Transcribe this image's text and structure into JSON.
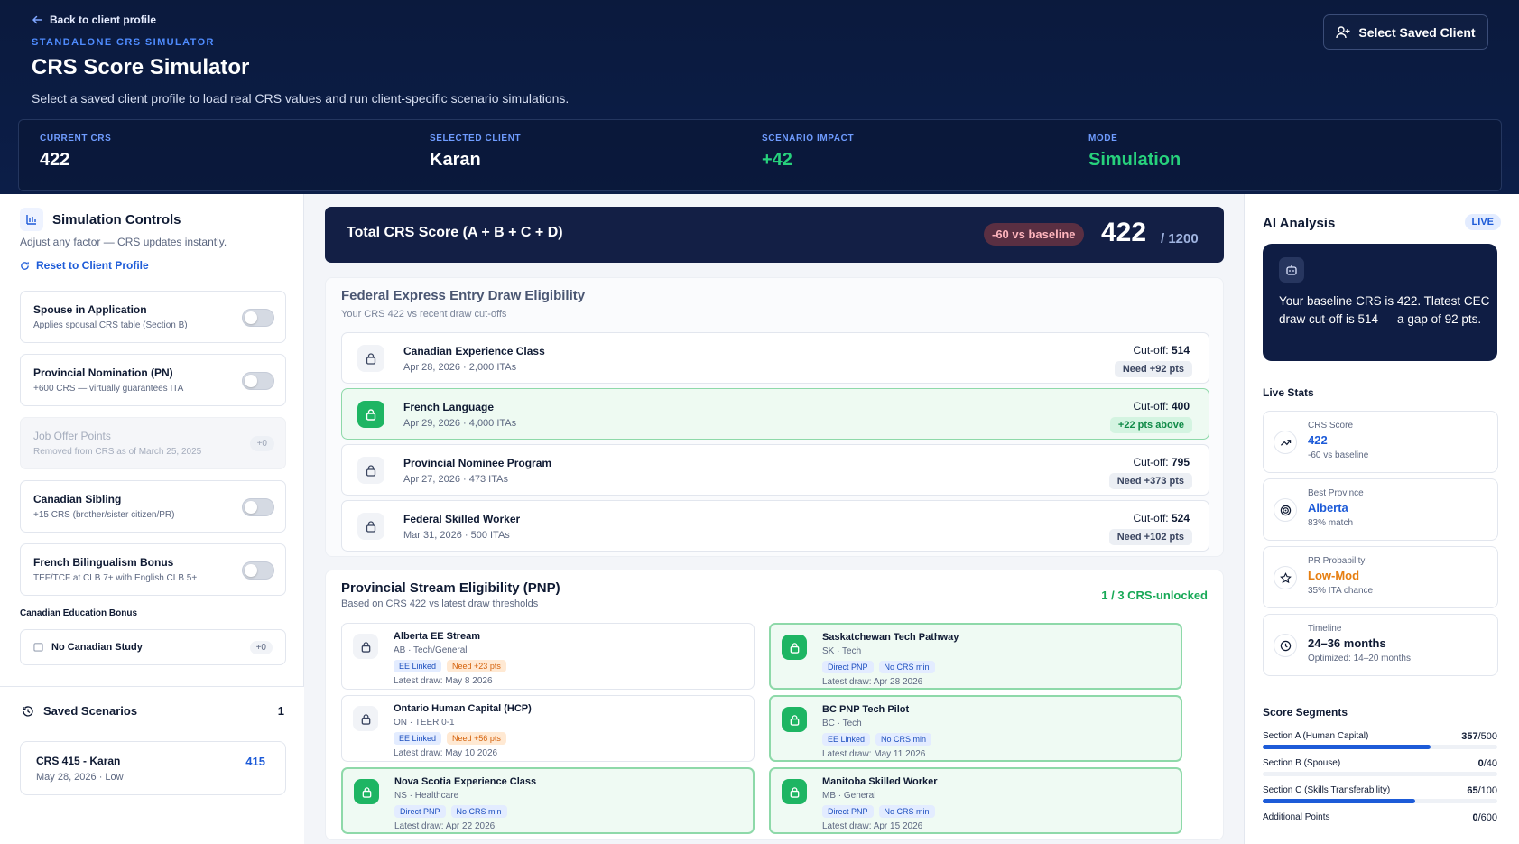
{
  "header": {
    "back_label": "Back to client profile",
    "eyebrow": "STANDALONE CRS SIMULATOR",
    "title": "CRS Score Simulator",
    "subtitle": "Select a saved client profile to load real CRS values and run client-specific scenario simulations.",
    "select_button": "Select Saved Client"
  },
  "stats": {
    "current_crs_label": "CURRENT CRS",
    "current_crs": "422",
    "client_label": "SELECTED CLIENT",
    "client": "Karan",
    "impact_label": "SCENARIO IMPACT",
    "impact": "+42",
    "mode_label": "MODE",
    "mode": "Simulation"
  },
  "controls": {
    "title": "Simulation Controls",
    "subtitle": "Adjust any factor — CRS updates instantly.",
    "reset": "Reset to Client Profile",
    "toggles": [
      {
        "title": "Spouse in Application",
        "desc": "Applies spousal CRS table (Section B)",
        "on": false
      },
      {
        "title": "Provincial Nomination (PN)",
        "desc": "+600 CRS — virtually guarantees ITA",
        "on": false
      },
      {
        "title": "Job Offer Points",
        "desc": "Removed from CRS as of March 25, 2025",
        "pill": "+0"
      },
      {
        "title": "Canadian Sibling",
        "desc": "+15 CRS (brother/sister citizen/PR)",
        "on": false
      },
      {
        "title": "French Bilingualism Bonus",
        "desc": "TEF/TCF at CLB 7+ with English CLB 5+",
        "on": false
      }
    ],
    "education_label": "Canadian Education Bonus",
    "education_value": "No Canadian Study",
    "education_pts": "+0"
  },
  "saved": {
    "title": "Saved Scenarios",
    "count": "1",
    "items": [
      {
        "name": "CRS 415 - Karan",
        "meta": "May 28, 2026 · Low",
        "score": "415"
      }
    ]
  },
  "total": {
    "label": "Total CRS Score (A + B + C + D)",
    "vs": "-60 vs baseline",
    "score": "422",
    "max": "/ 1200"
  },
  "federal": {
    "title": "Federal Express Entry Draw Eligibility",
    "subtitle": "Your CRS 422 vs recent draw cut-offs",
    "rows": [
      {
        "name": "Canadian Experience Class",
        "meta": "Apr 28, 2026 · 2,000 ITAs",
        "cutoff_label": "Cut-off:",
        "cutoff": "514",
        "need": "Need +92 pts",
        "ok": false
      },
      {
        "name": "French Language",
        "meta": "Apr 29, 2026 · 4,000 ITAs",
        "cutoff_label": "Cut-off:",
        "cutoff": "400",
        "need": "+22 pts above",
        "ok": true
      },
      {
        "name": "Provincial Nominee Program",
        "meta": "Apr 27, 2026 · 473 ITAs",
        "cutoff_label": "Cut-off:",
        "cutoff": "795",
        "need": "Need +373 pts",
        "ok": false
      },
      {
        "name": "Federal Skilled Worker",
        "meta": "Mar 31, 2026 · 500 ITAs",
        "cutoff_label": "Cut-off:",
        "cutoff": "524",
        "need": "Need +102 pts",
        "ok": false
      }
    ]
  },
  "pnp": {
    "title": "Provincial Stream Eligibility (PNP)",
    "subtitle": "Based on CRS 422 vs latest draw thresholds",
    "unlocked": "1 / 3 CRS-unlocked",
    "items": [
      {
        "name": "Alberta EE Stream",
        "region": "AB · Tech/General",
        "tags": [
          "EE Linked",
          "Need +23 pts"
        ],
        "latest": "Latest draw: May 8 2026",
        "ok": false
      },
      {
        "name": "Saskatchewan Tech Pathway",
        "region": "SK · Tech",
        "tags": [
          "Direct PNP",
          "No CRS min"
        ],
        "latest": "Latest draw: Apr 28 2026",
        "ok": true
      },
      {
        "name": "Ontario Human Capital (HCP)",
        "region": "ON · TEER 0-1",
        "tags": [
          "EE Linked",
          "Need +56 pts"
        ],
        "latest": "Latest draw: May 10 2026",
        "ok": false
      },
      {
        "name": "BC PNP Tech Pilot",
        "region": "BC · Tech",
        "tags": [
          "EE Linked",
          "No CRS min"
        ],
        "latest": "Latest draw: May 11 2026",
        "ok": true
      },
      {
        "name": "Nova Scotia Experience Class",
        "region": "NS · Healthcare",
        "tags": [
          "Direct PNP",
          "No CRS min"
        ],
        "latest": "Latest draw: Apr 22 2026",
        "ok": true
      },
      {
        "name": "Manitoba Skilled Worker",
        "region": "MB · General",
        "tags": [
          "Direct PNP",
          "No CRS min"
        ],
        "latest": "Latest draw: Apr 15 2026",
        "ok": true
      }
    ]
  },
  "ai": {
    "title": "AI Analysis",
    "badge": "LIVE",
    "text": "Your baseline CRS is 422. Tlatest CEC draw cut-off is 514 — a gap of 92 pts."
  },
  "live_stats": {
    "title": "Live Stats",
    "cards": [
      {
        "label": "CRS Score",
        "value": "422",
        "sub": "-60 vs baseline",
        "icon": "trend-icon",
        "color": "blue"
      },
      {
        "label": "Best Province",
        "value": "Alberta",
        "sub": "83% match",
        "icon": "target-icon",
        "color": "blue"
      },
      {
        "label": "PR Probability",
        "value": "Low-Mod",
        "sub": "35% ITA chance",
        "icon": "star-icon",
        "color": "orange"
      },
      {
        "label": "Timeline",
        "value": "24–36 months",
        "sub": "Optimized: 14–20 months",
        "icon": "clock-icon",
        "color": "dark"
      }
    ]
  },
  "segments": {
    "title": "Score Segments",
    "items": [
      {
        "label": "Section A (Human Capital)",
        "value": "357",
        "max": "/500",
        "fraction": 0.714
      },
      {
        "label": "Section B (Spouse)",
        "value": "0",
        "max": "/40",
        "fraction": 0
      },
      {
        "label": "Section C (Skills Transferability)",
        "value": "65",
        "max": "/100",
        "fraction": 0.65
      },
      {
        "label": "Additional Points",
        "value": "0",
        "max": "/600",
        "fraction": 0
      }
    ]
  },
  "colors": {
    "accent": "#1d5bd8",
    "success": "#18a957",
    "navy": "#0b1a3d"
  }
}
